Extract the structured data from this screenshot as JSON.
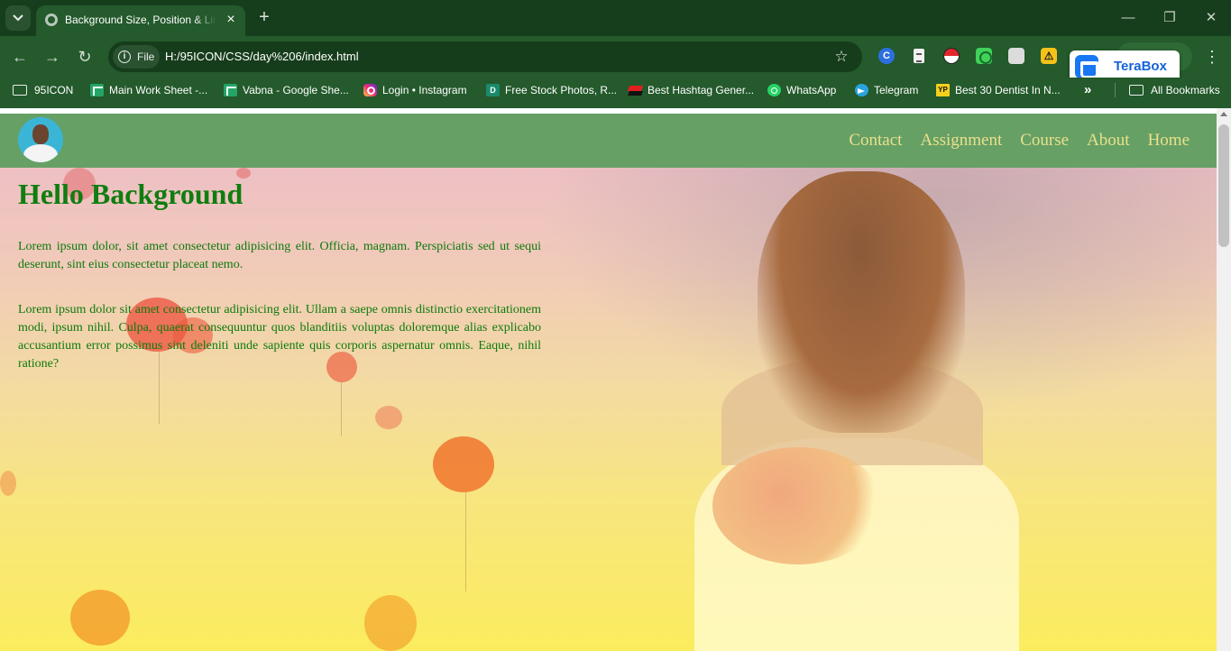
{
  "browser": {
    "tab_title": "Background Size, Position & Linear Gradient",
    "url_chip": "File",
    "url": "H:/95ICON/CSS/day%206/index.html",
    "extension_badge": "TeraBox",
    "bookmarks": [
      {
        "label": "95ICON",
        "icon": "folder-icon"
      },
      {
        "label": "Main Work Sheet -...",
        "icon": "google-sheets-icon"
      },
      {
        "label": "Vabna - Google She...",
        "icon": "google-sheets-icon"
      },
      {
        "label": "Login • Instagram",
        "icon": "instagram-icon"
      },
      {
        "label": "Free Stock Photos, R...",
        "icon": "stock-photos-icon"
      },
      {
        "label": "Best Hashtag Gener...",
        "icon": "hashtag-generator-icon"
      },
      {
        "label": "WhatsApp",
        "icon": "whatsapp-icon"
      },
      {
        "label": "Telegram",
        "icon": "telegram-icon"
      },
      {
        "label": "Best 30 Dentist In N...",
        "icon": "yellow-pages-icon"
      }
    ],
    "all_bookmarks": "All Bookmarks",
    "more_bookmarks": "»"
  },
  "page": {
    "nav": [
      "Contact",
      "Assignment",
      "Course",
      "About",
      "Home"
    ],
    "heading": "Hello Background",
    "paragraphs": [
      "Lorem ipsum dolor, sit amet consectetur adipisicing elit. Officia, magnam. Perspiciatis sed ut sequi deserunt, sint eius consectetur placeat nemo.",
      "Lorem ipsum dolor sit amet consectetur adipisicing elit. Ullam a saepe omnis distinctio exercitationem modi, ipsum nihil. Culpa, quaerat consequuntur quos blanditiis voluptas doloremque alias explicabo accusantium error possimus sint deleniti unde sapiente quis corporis aspernatur omnis. Eaque, nihil ratione?"
    ],
    "colors": {
      "navbar": "#66a065",
      "nav_link": "#e9e08c",
      "heading": "#107d10",
      "text": "#0d7a0d"
    }
  }
}
